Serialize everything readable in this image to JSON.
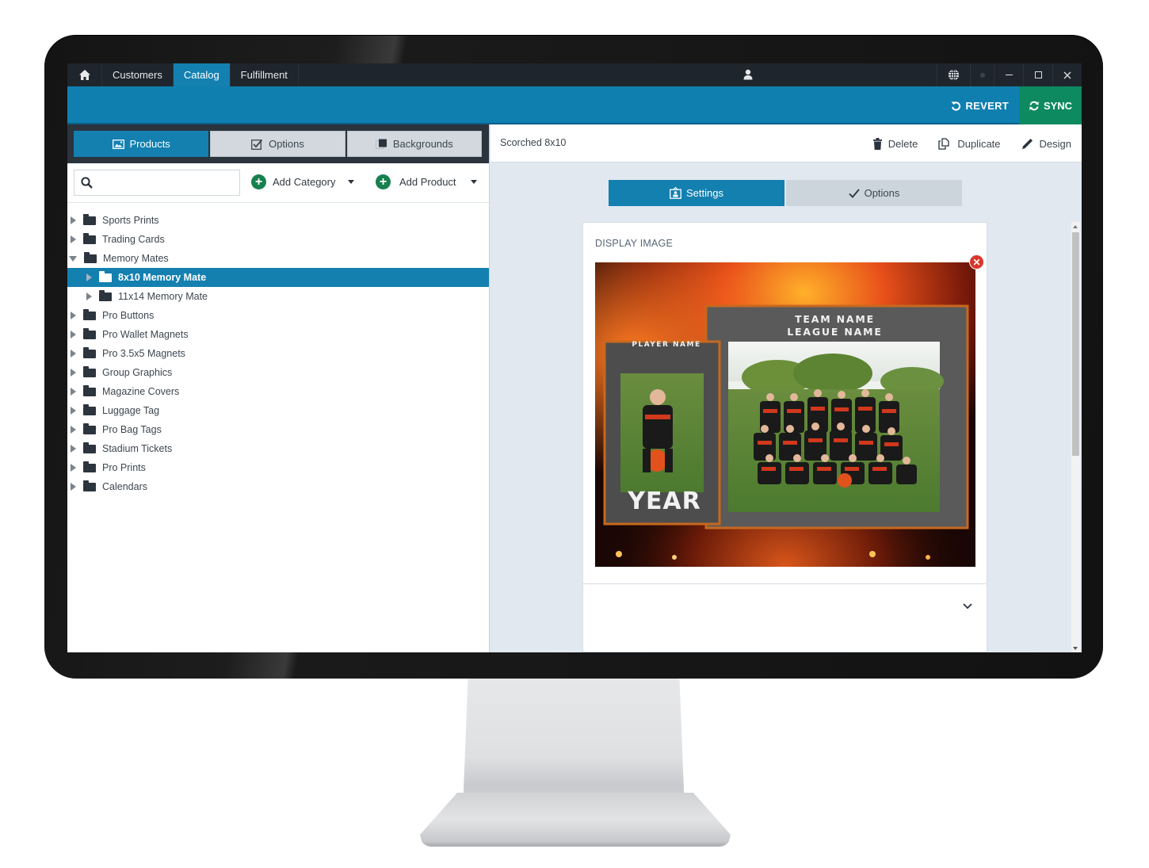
{
  "nav": {
    "home_icon": "home-icon",
    "tabs": [
      {
        "label": "Customers",
        "active": false
      },
      {
        "label": "Catalog",
        "active": true
      },
      {
        "label": "Fulfillment",
        "active": false
      }
    ],
    "user_icon": "user-icon",
    "window_controls": [
      "globe-icon",
      "status-dot",
      "minimize-icon",
      "maximize-icon",
      "close-icon"
    ]
  },
  "actionbar": {
    "revert_label": "REVERT",
    "sync_label": "SYNC"
  },
  "colors": {
    "primary": "#1380b0",
    "sync_green": "#0d8a5f",
    "add_green": "#17804f",
    "topbar": "#1f252d",
    "remove_red": "#d9362b"
  },
  "left": {
    "tabs": [
      {
        "label": "Products",
        "icon": "image-icon",
        "active": true
      },
      {
        "label": "Options",
        "icon": "checkbox-icon",
        "active": false
      },
      {
        "label": "Backgrounds",
        "icon": "background-icon",
        "active": false
      }
    ],
    "search": {
      "value": "",
      "placeholder": ""
    },
    "add_category_label": "Add Category",
    "add_product_label": "Add Product",
    "tree": [
      {
        "label": "Sports Prints",
        "level": 0,
        "expanded": false
      },
      {
        "label": "Trading Cards",
        "level": 0,
        "expanded": false
      },
      {
        "label": "Memory Mates",
        "level": 0,
        "expanded": true
      },
      {
        "label": "8x10 Memory Mate",
        "level": 1,
        "expanded": false,
        "selected": true
      },
      {
        "label": "11x14 Memory Mate",
        "level": 1,
        "expanded": false
      },
      {
        "label": "Pro Buttons",
        "level": 0,
        "expanded": false
      },
      {
        "label": "Pro Wallet Magnets",
        "level": 0,
        "expanded": false
      },
      {
        "label": "Pro 3.5x5 Magnets",
        "level": 0,
        "expanded": false
      },
      {
        "label": "Group Graphics",
        "level": 0,
        "expanded": false
      },
      {
        "label": "Magazine Covers",
        "level": 0,
        "expanded": false
      },
      {
        "label": "Luggage Tag",
        "level": 0,
        "expanded": false
      },
      {
        "label": "Pro Bag Tags",
        "level": 0,
        "expanded": false
      },
      {
        "label": "Stadium Tickets",
        "level": 0,
        "expanded": false
      },
      {
        "label": "Pro Prints",
        "level": 0,
        "expanded": false
      },
      {
        "label": "Calendars",
        "level": 0,
        "expanded": false
      }
    ]
  },
  "right": {
    "product_title": "Scorched 8x10",
    "actions": {
      "delete_label": "Delete",
      "duplicate_label": "Duplicate",
      "design_label": "Design"
    },
    "subtabs": [
      {
        "label": "Settings",
        "icon": "settings-badge-icon",
        "active": true
      },
      {
        "label": "Options",
        "icon": "checkmark-icon",
        "active": false
      }
    ],
    "card": {
      "section_label": "DISPLAY IMAGE",
      "image_text": {
        "team_name": "TEAM NAME",
        "league_name": "LEAGUE NAME",
        "player_name": "PLAYER NAME",
        "year": "YEAR"
      }
    }
  }
}
